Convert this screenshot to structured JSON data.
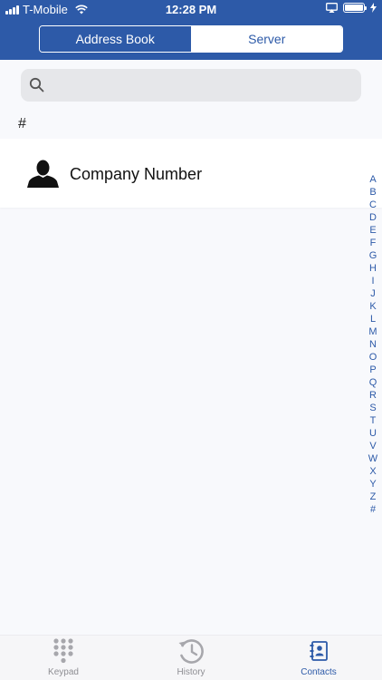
{
  "status_bar": {
    "carrier": "T-Mobile",
    "time": "12:28 PM"
  },
  "segmented": {
    "address_book": "Address Book",
    "server": "Server",
    "selected": "Server"
  },
  "search": {
    "placeholder": "",
    "value": ""
  },
  "section": {
    "header": "#"
  },
  "contacts": [
    {
      "name": "Company Number",
      "icon": "person-silhouette-icon"
    }
  ],
  "alpha_index": [
    "A",
    "B",
    "C",
    "D",
    "E",
    "F",
    "G",
    "H",
    "I",
    "J",
    "K",
    "L",
    "M",
    "N",
    "O",
    "P",
    "Q",
    "R",
    "S",
    "T",
    "U",
    "V",
    "W",
    "X",
    "Y",
    "Z",
    "#"
  ],
  "tabs": {
    "keypad": "Keypad",
    "history": "History",
    "contacts": "Contacts",
    "active": "Contacts"
  },
  "colors": {
    "brand": "#2d5aa8",
    "background": "#f8f9fc",
    "inactive_tab": "#8e8e93"
  }
}
